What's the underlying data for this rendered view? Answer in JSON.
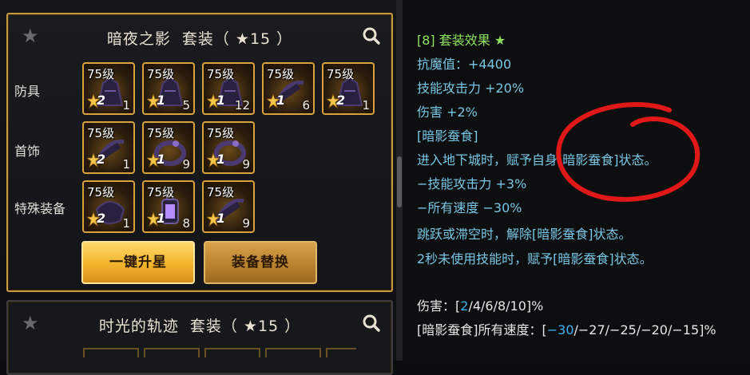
{
  "sets": [
    {
      "title": "暗夜之影  套装（ ★15 ）",
      "categories": [
        "防具",
        "首饰",
        "特殊装备"
      ],
      "rows": [
        {
          "category": "防具",
          "items": [
            {
              "level": "75级",
              "tier": "2",
              "count": "1",
              "icon": "helmet-icon"
            },
            {
              "level": "75级",
              "tier": "1",
              "count": "5",
              "icon": "armor-icon"
            },
            {
              "level": "75级",
              "tier": "1",
              "count": "12",
              "icon": "shoulder-icon"
            },
            {
              "level": "75级",
              "tier": "1",
              "count": "6",
              "icon": "belt-icon"
            },
            {
              "level": "75级",
              "tier": "2",
              "count": "1",
              "icon": "boots-icon"
            }
          ]
        },
        {
          "category": "首饰",
          "items": [
            {
              "level": "75级",
              "tier": "2",
              "count": "1",
              "icon": "necklace-icon"
            },
            {
              "level": "75级",
              "tier": "1",
              "count": "9",
              "icon": "bracelet-icon"
            },
            {
              "level": "75级",
              "tier": "1",
              "count": "9",
              "icon": "ring-icon"
            }
          ]
        },
        {
          "category": "特殊装备",
          "items": [
            {
              "level": "75级",
              "tier": "2",
              "count": "1",
              "icon": "shield-icon"
            },
            {
              "level": "75级",
              "tier": "1",
              "count": "8",
              "icon": "lantern-icon"
            },
            {
              "level": "75级",
              "tier": "1",
              "count": "9",
              "icon": "earring-icon"
            }
          ]
        }
      ],
      "buttons": {
        "upstar": "一键升星",
        "replace": "装备替换"
      }
    },
    {
      "title": "时光的轨迹  套装（ ★15 ）"
    }
  ],
  "effect": {
    "header": "[8] 套装效果 ★",
    "lines": [
      "抗魔值：+4400",
      "技能攻击力 +20%",
      "伤害 +2%",
      "[暗影蚕食]",
      "进入地下城时，赋予自身[暗影蚕食]状态。",
      "−技能攻击力 +3%",
      "−所有速度 −30%",
      "跳跃或滞空时，解除[暗影蚕食]状态。",
      "2秒未使用技能时，赋予[暗影蚕食]状态。"
    ],
    "damage_prefix": "伤害：[",
    "damage_first": "2",
    "damage_rest": "/4/6/8/10]%",
    "speed_prefix": "[暗影蚕食]所有速度：[",
    "speed_first": "−30",
    "speed_rest": "/−27/−25/−20/−15]%"
  },
  "colors": {
    "gold_border": "#c89a3c",
    "effect_text": "#79c7e4",
    "effect_header": "#8ee15c",
    "highlight": "#3fb3ee",
    "annotation": "#e01818"
  }
}
